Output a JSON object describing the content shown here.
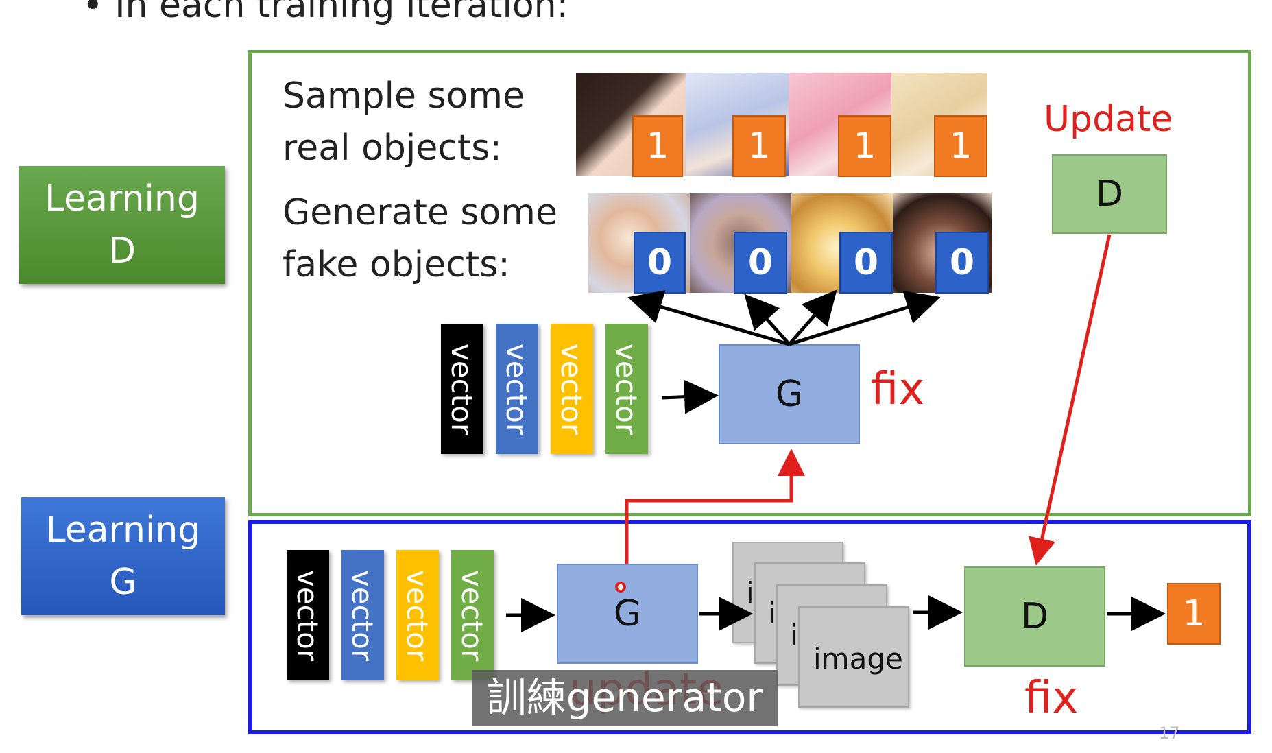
{
  "heading": "• In each training iteration:",
  "side": {
    "learning_d_line1": "Learning",
    "learning_d_line2": "D",
    "learning_g_line1": "Learning",
    "learning_g_line2": "G"
  },
  "learning_d": {
    "sample_line1": "Sample some",
    "sample_line2": "real objects:",
    "generate_line1": "Generate some",
    "generate_line2": "fake objects:",
    "real_labels": [
      "1",
      "1",
      "1",
      "1"
    ],
    "fake_labels": [
      "0",
      "0",
      "0",
      "0"
    ],
    "update_label": "Update",
    "d_box": "D",
    "g_box": "G",
    "fix_label": "fix",
    "vectors": [
      "vector",
      "vector",
      "vector",
      "vector"
    ]
  },
  "learning_g": {
    "vectors": [
      "vector",
      "vector",
      "vector",
      "vector"
    ],
    "g_box": "G",
    "update_label": "update",
    "image_cards": [
      "i",
      "i",
      "i",
      "image"
    ],
    "d_box": "D",
    "fix_label": "fix",
    "output": "1"
  },
  "subtitle": "訓練generator",
  "page_number": "17",
  "colors": {
    "green": "#6aa84f",
    "blue_frame": "#1b1de6",
    "red": "#e0201c",
    "orange": "#f07b22",
    "badge_blue": "#2d63c8",
    "vector_black": "#000000",
    "vector_blue": "#4472c4",
    "vector_yellow": "#ffc000",
    "vector_green": "#70ad47"
  }
}
